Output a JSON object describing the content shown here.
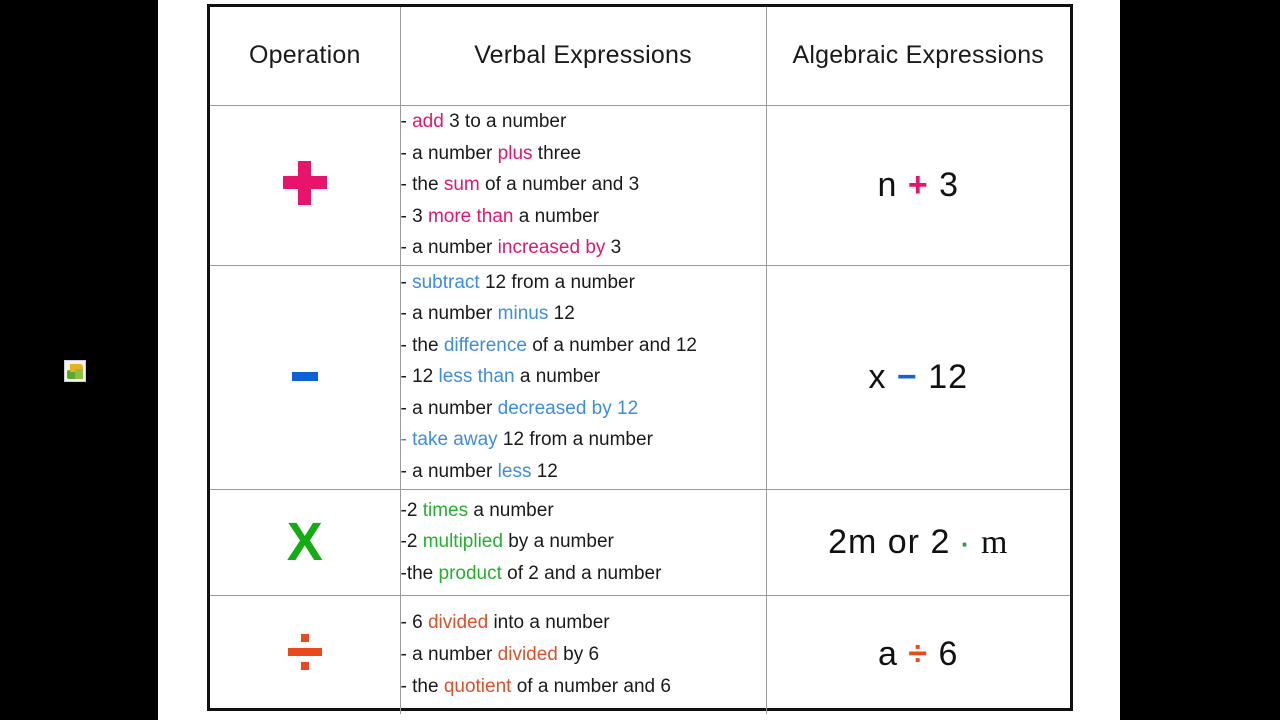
{
  "slide": {
    "desktop_icon_name": "recycle-arrows-icon"
  },
  "table": {
    "headers": {
      "operation": "Operation",
      "verbal": "Verbal Expressions",
      "algebraic": "Algebraic Expressions"
    },
    "colors": {
      "addition": "#e6156b",
      "subtraction": "#3d8ce0",
      "subtraction_symbol": "#0b62d6",
      "multiplication": "#27ae31",
      "multiplication_symbol": "#13ac13",
      "division": "#d9522b",
      "division_symbol": "#e8491d",
      "text": "#1a1a1a",
      "border": "#101010"
    },
    "rows": [
      {
        "operation_symbol": "+",
        "operation_icon": "plus-sign-icon",
        "verbal": [
          {
            "pre": "- ",
            "key": "add",
            "post": " 3 to a number"
          },
          {
            "pre": "- a number ",
            "key": "plus",
            "post": " three"
          },
          {
            "pre": "- the ",
            "key": "sum",
            "post": " of a number and 3"
          },
          {
            "pre": "- 3 ",
            "key": "more than",
            "post": " a number"
          },
          {
            "pre": "- a number ",
            "key": "increased by",
            "post": " 3"
          }
        ],
        "algebraic": {
          "left": "n",
          "op": "+",
          "right": "3"
        }
      },
      {
        "operation_symbol": "−",
        "operation_icon": "minus-sign-icon",
        "verbal": [
          {
            "pre": "- ",
            "key": "subtract",
            "post": " 12 from a number"
          },
          {
            "pre": "- a number ",
            "key": "minus",
            "post": " 12"
          },
          {
            "pre": "- the ",
            "key": "difference",
            "post": " of a number and 12"
          },
          {
            "pre": "- 12 ",
            "key": "less than",
            "post": " a number"
          },
          {
            "pre": "- a number ",
            "key": "decreased by 12",
            "post": ""
          },
          {
            "pre": "",
            "key": "- take away",
            "post": " 12 from a number"
          },
          {
            "pre": "- a number ",
            "key": "less",
            "post": " 12"
          }
        ],
        "algebraic": {
          "left": "x",
          "op": "−",
          "right": "12"
        }
      },
      {
        "operation_symbol": "X",
        "operation_icon": "multiplication-x-icon",
        "verbal": [
          {
            "pre": "-2 ",
            "key": "times",
            "post": " a number"
          },
          {
            "pre": "-2 ",
            "key": "multiplied",
            "post": " by a number"
          },
          {
            "pre": "-the ",
            "key": "product",
            "post": " of 2 and a number"
          }
        ],
        "algebraic": {
          "left": "2m or 2",
          "op": "·",
          "right": "m"
        }
      },
      {
        "operation_symbol": "÷",
        "operation_icon": "division-sign-icon",
        "verbal": [
          {
            "pre": "- 6 ",
            "key": "divided",
            "post": " into a number"
          },
          {
            "pre": "- a number ",
            "key": "divided",
            "post": " by 6"
          },
          {
            "pre": "- the ",
            "key": "quotient",
            "post": " of a number and 6"
          }
        ],
        "algebraic": {
          "left": "a",
          "op": "÷",
          "right": "6"
        }
      }
    ]
  }
}
